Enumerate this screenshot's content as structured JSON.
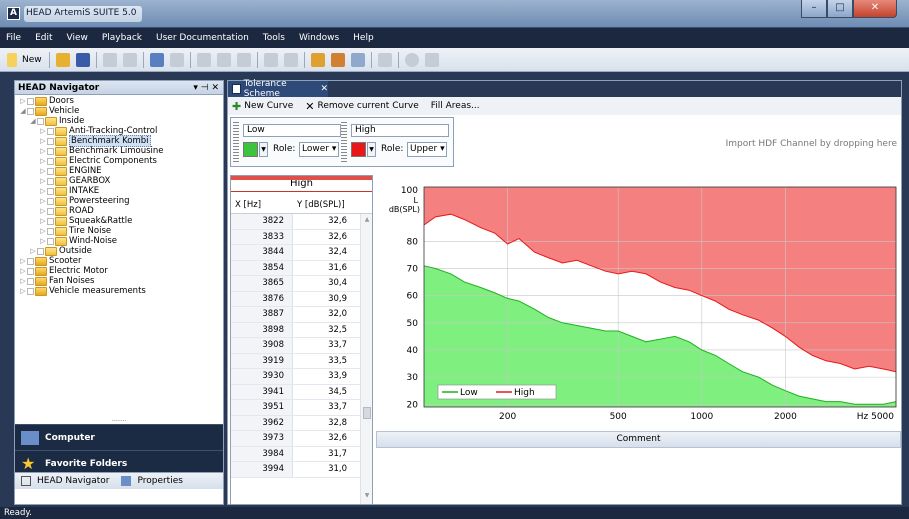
{
  "app": {
    "title": "HEAD ArtemiS SUITE 5.0"
  },
  "menu": [
    "File",
    "Edit",
    "View",
    "Playback",
    "User Documentation",
    "Tools",
    "Windows",
    "Help"
  ],
  "toolbar": {
    "new_label": "New"
  },
  "navigator": {
    "title": "HEAD Navigator",
    "pins": "▾ ⊣ ✕",
    "tree": [
      {
        "label": "Doors",
        "level": 0,
        "expand": "closed",
        "folder": "alt"
      },
      {
        "label": "Vehicle",
        "level": 0,
        "expand": "open",
        "folder": "alt"
      },
      {
        "label": "Inside",
        "level": 1,
        "expand": "open",
        "folder": "normal"
      },
      {
        "label": "Anti-Tracking-Control",
        "level": 2,
        "expand": "closed",
        "folder": "normal"
      },
      {
        "label": "Benchmark Kombi",
        "level": 2,
        "expand": "closed",
        "folder": "normal",
        "selected": true
      },
      {
        "label": "Benchmark Limousine",
        "level": 2,
        "expand": "closed",
        "folder": "normal"
      },
      {
        "label": "Electric Components",
        "level": 2,
        "expand": "closed",
        "folder": "normal"
      },
      {
        "label": "ENGINE",
        "level": 2,
        "expand": "closed",
        "folder": "normal"
      },
      {
        "label": "GEARBOX",
        "level": 2,
        "expand": "closed",
        "folder": "normal"
      },
      {
        "label": "INTAKE",
        "level": 2,
        "expand": "closed",
        "folder": "normal"
      },
      {
        "label": "Powersteering",
        "level": 2,
        "expand": "closed",
        "folder": "normal"
      },
      {
        "label": "ROAD",
        "level": 2,
        "expand": "closed",
        "folder": "normal"
      },
      {
        "label": "Squeak&Rattle",
        "level": 2,
        "expand": "closed",
        "folder": "normal"
      },
      {
        "label": "Tire Noise",
        "level": 2,
        "expand": "closed",
        "folder": "normal"
      },
      {
        "label": "Wind-Noise",
        "level": 2,
        "expand": "closed",
        "folder": "normal"
      },
      {
        "label": "Outside",
        "level": 1,
        "expand": "closed",
        "folder": "normal"
      },
      {
        "label": "Scooter",
        "level": 0,
        "expand": "closed",
        "folder": "alt"
      },
      {
        "label": "Electric Motor",
        "level": 0,
        "expand": "closed",
        "folder": "alt"
      },
      {
        "label": "Fan Noises",
        "level": 0,
        "expand": "closed",
        "folder": "alt"
      },
      {
        "label": "Vehicle measurements",
        "level": 0,
        "expand": "closed",
        "folder": "alt"
      }
    ],
    "dots": "········",
    "computer": "Computer",
    "favorites": "Favorite Folders",
    "tab_navigator": "HEAD Navigator",
    "tab_properties": "Properties"
  },
  "document": {
    "tab_label": "Tolerance Scheme",
    "tab_close": "✕",
    "new_curve": "New Curve",
    "remove_curve": "Remove current Curve",
    "fill_areas": "Fill Areas...",
    "curve_low": {
      "name": "Low",
      "role_label": "Role:",
      "role": "Lower",
      "color": "#3cc43c"
    },
    "curve_high": {
      "name": "High",
      "role_label": "Role:",
      "role": "Upper",
      "color": "#e81818"
    },
    "import_hint": "Import HDF Channel by dropping here"
  },
  "table": {
    "title": "High",
    "col_x": "X [Hz]",
    "col_y": "Y [dB(SPL)]",
    "rows": [
      [
        "3822",
        "32,6"
      ],
      [
        "3833",
        "32,6"
      ],
      [
        "3844",
        "32,4"
      ],
      [
        "3854",
        "31,6"
      ],
      [
        "3865",
        "30,4"
      ],
      [
        "3876",
        "30,9"
      ],
      [
        "3887",
        "32,0"
      ],
      [
        "3898",
        "32,5"
      ],
      [
        "3908",
        "33,7"
      ],
      [
        "3919",
        "33,5"
      ],
      [
        "3930",
        "33,9"
      ],
      [
        "3941",
        "34,5"
      ],
      [
        "3951",
        "33,7"
      ],
      [
        "3962",
        "32,8"
      ],
      [
        "3973",
        "32,6"
      ],
      [
        "3984",
        "31,7"
      ],
      [
        "3994",
        "31,0"
      ]
    ]
  },
  "comment": "Comment",
  "status": "Ready.",
  "chart_data": {
    "type": "area",
    "xscale": "log",
    "xlim": [
      100,
      5000
    ],
    "ylim": [
      19,
      100
    ],
    "xticks": [
      "200",
      "500",
      "1000",
      "2000",
      "Hz 5000"
    ],
    "xtick_values": [
      200,
      500,
      1000,
      2000,
      5000
    ],
    "yticks": [
      20,
      30,
      40,
      50,
      60,
      70,
      80
    ],
    "ylabel_top": "100",
    "ylabel_unit1": "L",
    "ylabel_unit2": "dB(SPL)",
    "grid": true,
    "legend": {
      "placement": "bottom-left",
      "entries": [
        "Low",
        "High"
      ]
    },
    "series": [
      {
        "name": "High",
        "color": "#e81818",
        "fill": "#f58080",
        "x": [
          100,
          110,
          125,
          140,
          160,
          180,
          200,
          220,
          250,
          280,
          315,
          355,
          400,
          450,
          500,
          560,
          630,
          710,
          800,
          900,
          1000,
          1120,
          1250,
          1400,
          1600,
          1800,
          2000,
          2240,
          2500,
          2800,
          3150,
          3550,
          4000,
          4500,
          5000
        ],
        "values": [
          86,
          89,
          90,
          88,
          85,
          83,
          79,
          81,
          76,
          74,
          72,
          73,
          71,
          69,
          68,
          69,
          68,
          65,
          63,
          62,
          60,
          58,
          55,
          53,
          51,
          48,
          45,
          41,
          38,
          36,
          35,
          33,
          34,
          33,
          32
        ]
      },
      {
        "name": "Low",
        "color": "#20b020",
        "fill": "#7fef7f",
        "x": [
          100,
          110,
          125,
          140,
          160,
          180,
          200,
          220,
          250,
          280,
          315,
          355,
          400,
          450,
          500,
          560,
          630,
          710,
          800,
          900,
          1000,
          1120,
          1250,
          1400,
          1600,
          1800,
          2000,
          2240,
          2500,
          2800,
          3150,
          3550,
          4000,
          4500,
          5000
        ],
        "values": [
          71,
          70,
          68,
          65,
          63,
          61,
          59,
          58,
          55,
          52,
          50,
          49,
          48,
          47,
          47,
          45,
          43,
          44,
          45,
          43,
          40,
          38,
          35,
          32,
          30,
          27,
          25,
          23,
          22,
          21,
          21,
          20,
          20,
          20,
          21
        ]
      }
    ]
  }
}
